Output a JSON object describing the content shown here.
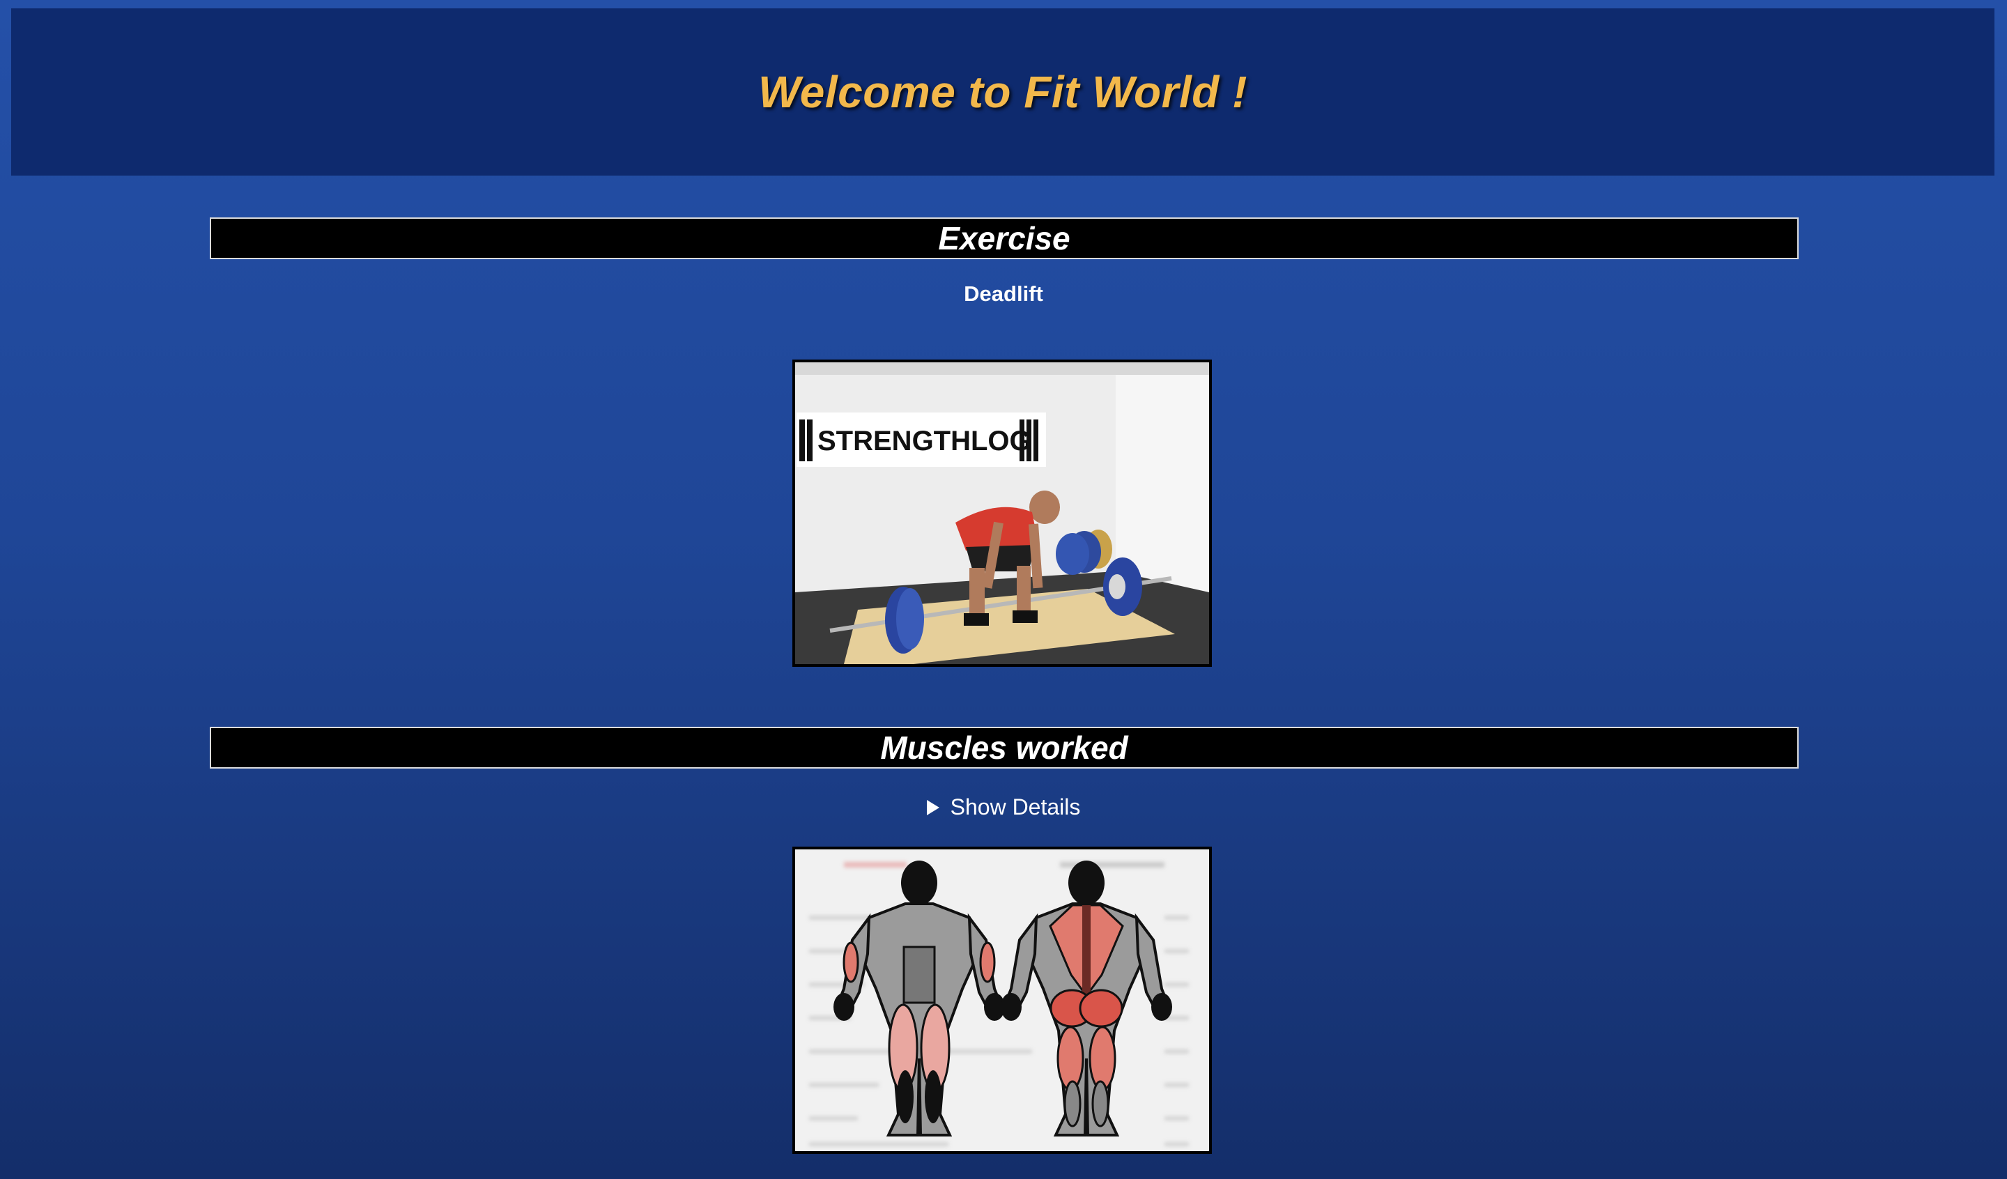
{
  "header": {
    "title": "Welcome to Fit World !"
  },
  "exercise_section": {
    "heading": "Exercise",
    "name": "Deadlift",
    "banner_text": "STRENGTHLOG"
  },
  "muscles_section": {
    "heading": "Muscles worked",
    "toggle_label": "Show Details"
  },
  "colors": {
    "page_bg": "#2450a8",
    "header_bg": "#0e2a6e",
    "title": "#f2b84b",
    "bar_bg": "#000000",
    "muscle_highlight": "#e07a6e"
  }
}
